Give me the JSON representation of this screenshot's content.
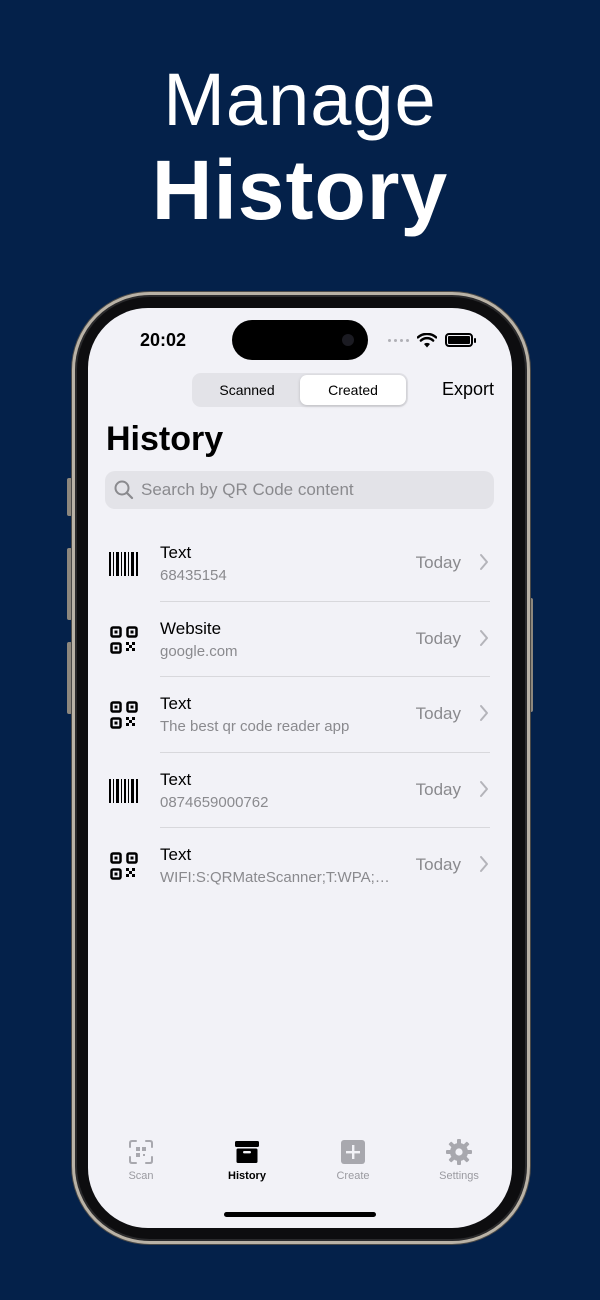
{
  "headline": {
    "line1": "Manage",
    "line2": "History"
  },
  "status_bar": {
    "time": "20:02"
  },
  "header": {
    "segments": [
      {
        "label": "Scanned",
        "active": false
      },
      {
        "label": "Created",
        "active": true
      }
    ],
    "export_label": "Export",
    "title": "History"
  },
  "search": {
    "placeholder": "Search by QR Code content",
    "value": ""
  },
  "items": [
    {
      "icon": "barcode-icon",
      "title": "Text",
      "subtitle": "68435154",
      "date": "Today"
    },
    {
      "icon": "qr-code-icon",
      "title": "Website",
      "subtitle": "google.com",
      "date": "Today"
    },
    {
      "icon": "qr-code-icon",
      "title": "Text",
      "subtitle": "The best qr code reader app",
      "date": "Today"
    },
    {
      "icon": "barcode-icon",
      "title": "Text",
      "subtitle": "0874659000762",
      "date": "Today"
    },
    {
      "icon": "qr-code-icon",
      "title": "Text",
      "subtitle": "WIFI:S:QRMateScanner;T:WPA;…",
      "date": "Today"
    }
  ],
  "tabs": [
    {
      "label": "Scan",
      "icon": "scan-icon",
      "active": false
    },
    {
      "label": "History",
      "icon": "archive-box-icon",
      "active": true
    },
    {
      "label": "Create",
      "icon": "plus-square-icon",
      "active": false
    },
    {
      "label": "Settings",
      "icon": "gear-icon",
      "active": false
    }
  ],
  "colors": {
    "background": "#04214a",
    "screen": "#f2f2f7",
    "secondary_text": "#8a8a8e"
  }
}
